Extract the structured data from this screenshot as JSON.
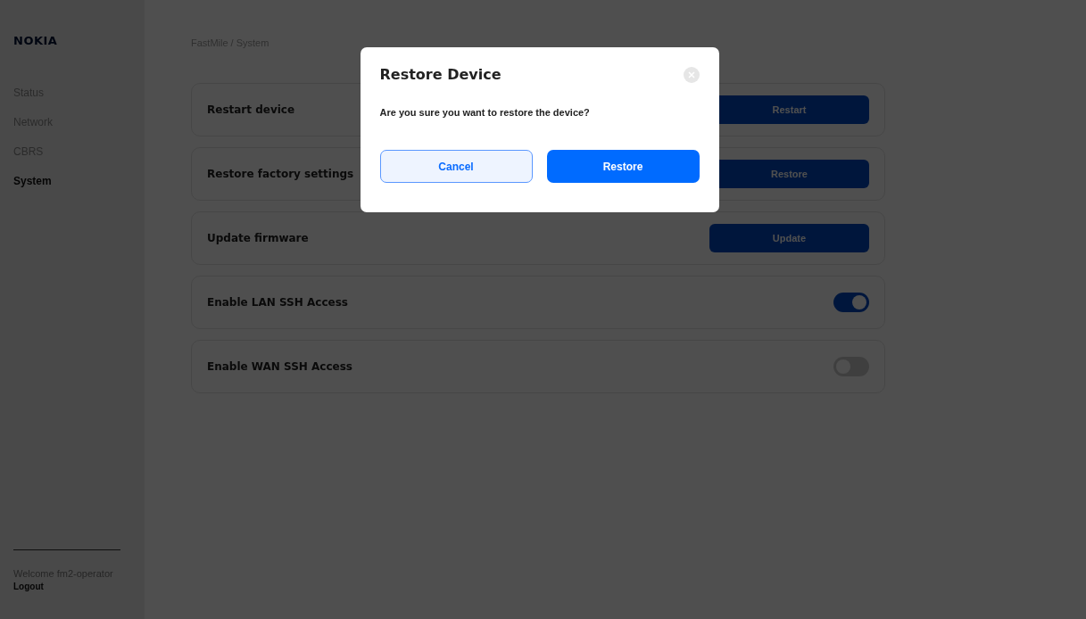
{
  "logo": "NOKIA",
  "sidebar": {
    "items": [
      {
        "label": "Status",
        "selected": false
      },
      {
        "label": "Network",
        "selected": false
      },
      {
        "label": "CBRS",
        "selected": false
      },
      {
        "label": "System",
        "selected": true
      }
    ],
    "welcome": "Welcome fm2-operator",
    "logout": "Logout"
  },
  "breadcrumb": "FastMile / System",
  "settings": [
    {
      "kind": "button",
      "label": "Restart device",
      "action": "Restart"
    },
    {
      "kind": "button",
      "label": "Restore factory settings",
      "action": "Restore"
    },
    {
      "kind": "button",
      "label": "Update firmware",
      "action": "Update"
    },
    {
      "kind": "toggle",
      "label": "Enable LAN SSH Access",
      "on": true
    },
    {
      "kind": "toggle",
      "label": "Enable WAN SSH Access",
      "on": false
    }
  ],
  "dialog": {
    "title": "Restore Device",
    "message": "Are you sure you want to restore the device?",
    "cancel": "Cancel",
    "confirm": "Restore"
  }
}
